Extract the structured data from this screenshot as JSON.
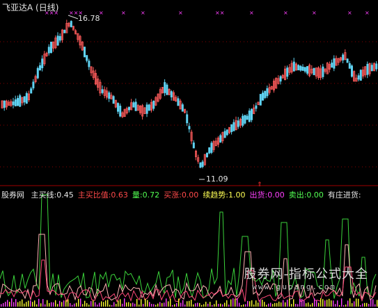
{
  "window": {
    "title": "飞亚达A (日线)"
  },
  "price_panel": {
    "high_label": "16.78",
    "low_label": "11.09",
    "signal_glyph": "XXX",
    "colors": {
      "up": "#ff5b5b",
      "down": "#5fd3f2",
      "signal": "#ff40ff",
      "grid": "#8a0000"
    }
  },
  "indicator_panel": {
    "source": "股券网",
    "items": [
      {
        "label": "主买线:",
        "value": "0.45",
        "color": "#e6e6e6"
      },
      {
        "label": "主买比值:",
        "value": "0.63",
        "color": "#ff4a4a"
      },
      {
        "label": "量:",
        "value": "0.72",
        "color": "#53ff53"
      },
      {
        "label": "买涨:",
        "value": "0.00",
        "color": "#ff4a4a"
      },
      {
        "label": "续趋势:",
        "value": "1.00",
        "color": "#ffff55"
      },
      {
        "label": "出货:",
        "value": "0.00",
        "color": "#ff40ff"
      },
      {
        "label": "卖出:",
        "value": "0.00",
        "color": "#53ff53"
      },
      {
        "label": "有庄进货:",
        "value": "",
        "color": "#e6e6e6"
      }
    ]
  },
  "watermark": {
    "main": "股券网-指标公式大全",
    "sub": "www.gupang.com"
  }
}
